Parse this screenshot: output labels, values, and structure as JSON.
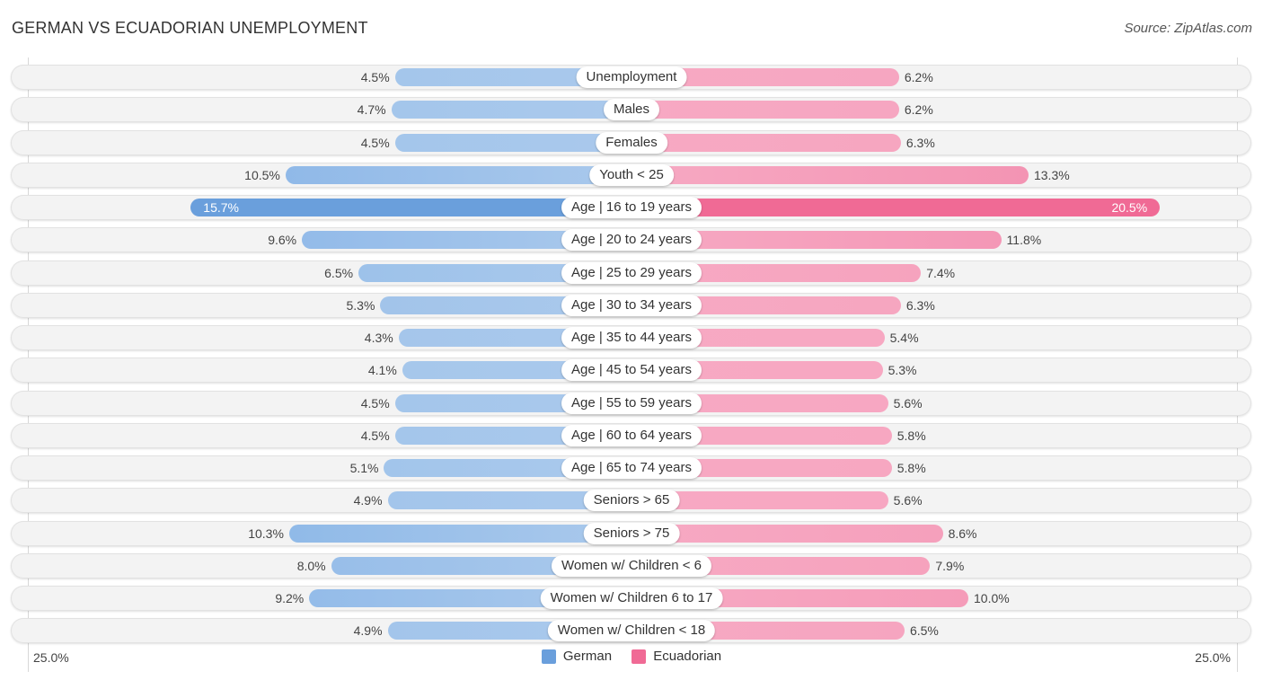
{
  "header": {
    "title": "GERMAN VS ECUADORIAN UNEMPLOYMENT",
    "source": "Source: ZipAtlas.com"
  },
  "chart_data": {
    "type": "bar",
    "orientation": "diverging-horizontal",
    "title": "GERMAN VS ECUADORIAN UNEMPLOYMENT",
    "xlabel": "",
    "ylabel": "",
    "xlim": [
      -25.0,
      25.0
    ],
    "axis_labels": {
      "left": "25.0%",
      "right": "25.0%"
    },
    "legend": {
      "placement": "bottom-center",
      "entries": [
        "German",
        "Ecuadorian"
      ]
    },
    "colors": {
      "German": "#6a9fdc",
      "Ecuadorian": "#f06a95",
      "German_light": "#a6c7eb",
      "Ecuadorian_light": "#f6a4c0"
    },
    "categories": [
      "Unemployment",
      "Males",
      "Females",
      "Youth < 25",
      "Age | 16 to 19 years",
      "Age | 20 to 24 years",
      "Age | 25 to 29 years",
      "Age | 30 to 34 years",
      "Age | 35 to 44 years",
      "Age | 45 to 54 years",
      "Age | 55 to 59 years",
      "Age | 60 to 64 years",
      "Age | 65 to 74 years",
      "Seniors > 65",
      "Seniors > 75",
      "Women w/ Children < 6",
      "Women w/ Children 6 to 17",
      "Women w/ Children < 18"
    ],
    "series": [
      {
        "name": "German",
        "values": [
          4.5,
          4.7,
          4.5,
          10.5,
          15.7,
          9.6,
          6.5,
          5.3,
          4.3,
          4.1,
          4.5,
          4.5,
          5.1,
          4.9,
          10.3,
          8.0,
          9.2,
          4.9
        ],
        "labels": [
          "4.5%",
          "4.7%",
          "4.5%",
          "10.5%",
          "15.7%",
          "9.6%",
          "6.5%",
          "5.3%",
          "4.3%",
          "4.1%",
          "4.5%",
          "4.5%",
          "5.1%",
          "4.9%",
          "10.3%",
          "8.0%",
          "9.2%",
          "4.9%"
        ]
      },
      {
        "name": "Ecuadorian",
        "values": [
          6.2,
          6.2,
          6.3,
          13.3,
          20.5,
          11.8,
          7.4,
          6.3,
          5.4,
          5.3,
          5.6,
          5.8,
          5.8,
          5.6,
          8.6,
          7.9,
          10.0,
          6.5
        ],
        "labels": [
          "6.2%",
          "6.2%",
          "6.3%",
          "13.3%",
          "20.5%",
          "11.8%",
          "7.4%",
          "6.3%",
          "5.4%",
          "5.3%",
          "5.6%",
          "5.8%",
          "5.8%",
          "5.6%",
          "8.6%",
          "7.9%",
          "10.0%",
          "6.5%"
        ]
      }
    ],
    "highlighted_category": "Age | 16 to 19 years"
  }
}
